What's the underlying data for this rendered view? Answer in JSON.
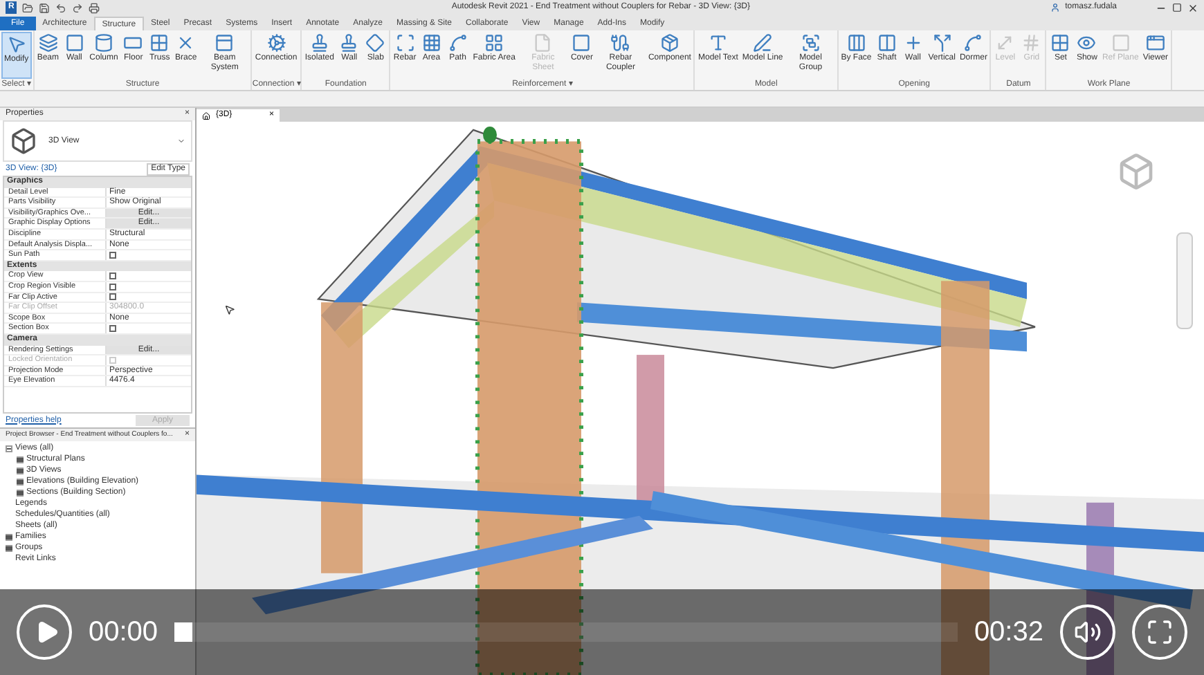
{
  "window": {
    "logo": "R",
    "title": "Autodesk Revit 2021 - End Treatment without Couplers for Rebar - 3D View: {3D}",
    "user": "tomasz.fudala"
  },
  "ribbon": {
    "tabs": [
      {
        "label": "File",
        "kind": "file",
        "selected": false
      },
      {
        "label": "Architecture",
        "kind": "tab",
        "selected": false
      },
      {
        "label": "Structure",
        "kind": "tab",
        "selected": true
      },
      {
        "label": "Steel",
        "kind": "tab",
        "selected": false
      },
      {
        "label": "Precast",
        "kind": "tab",
        "selected": false
      },
      {
        "label": "Systems",
        "kind": "tab",
        "selected": false
      },
      {
        "label": "Insert",
        "kind": "tab",
        "selected": false
      },
      {
        "label": "Annotate",
        "kind": "tab",
        "selected": false
      },
      {
        "label": "Analyze",
        "kind": "tab",
        "selected": false
      },
      {
        "label": "Massing & Site",
        "kind": "tab",
        "selected": false
      },
      {
        "label": "Collaborate",
        "kind": "tab",
        "selected": false
      },
      {
        "label": "View",
        "kind": "tab",
        "selected": false
      },
      {
        "label": "Manage",
        "kind": "tab",
        "selected": false
      },
      {
        "label": "Add-Ins",
        "kind": "tab",
        "selected": false
      },
      {
        "label": "Modify",
        "kind": "tab",
        "selected": false
      }
    ],
    "panels": [
      {
        "label": "Select ▾",
        "buttons": [
          {
            "label": "Modify",
            "selected": true,
            "disabled": false
          }
        ]
      },
      {
        "label": "Structure",
        "buttons": [
          {
            "label": "Beam",
            "selected": false,
            "disabled": false
          },
          {
            "label": "Wall",
            "selected": false,
            "disabled": false
          },
          {
            "label": "Column",
            "selected": false,
            "disabled": false
          },
          {
            "label": "Floor",
            "selected": false,
            "disabled": false
          },
          {
            "label": "Truss",
            "selected": false,
            "disabled": false
          },
          {
            "label": "Brace",
            "selected": false,
            "disabled": false
          },
          {
            "label": "Beam System",
            "selected": false,
            "disabled": false
          }
        ]
      },
      {
        "label": "Connection ▾",
        "buttons": [
          {
            "label": "Connection",
            "selected": false,
            "disabled": false
          }
        ]
      },
      {
        "label": "Foundation",
        "buttons": [
          {
            "label": "Isolated",
            "selected": false,
            "disabled": false
          },
          {
            "label": "Wall",
            "selected": false,
            "disabled": false
          },
          {
            "label": "Slab",
            "selected": false,
            "disabled": false
          }
        ]
      },
      {
        "label": "Reinforcement ▾",
        "buttons": [
          {
            "label": "Rebar",
            "selected": false,
            "disabled": false
          },
          {
            "label": "Area",
            "selected": false,
            "disabled": false
          },
          {
            "label": "Path",
            "selected": false,
            "disabled": false
          },
          {
            "label": "Fabric Area",
            "selected": false,
            "disabled": false
          },
          {
            "label": "Fabric Sheet",
            "selected": false,
            "disabled": true
          },
          {
            "label": "Cover",
            "selected": false,
            "disabled": false
          },
          {
            "label": "Rebar Coupler",
            "selected": false,
            "disabled": false
          },
          {
            "label": "Component",
            "selected": false,
            "disabled": false
          }
        ]
      },
      {
        "label": "Model",
        "buttons": [
          {
            "label": "Model Text",
            "selected": false,
            "disabled": false
          },
          {
            "label": "Model Line",
            "selected": false,
            "disabled": false
          },
          {
            "label": "Model Group",
            "selected": false,
            "disabled": false
          }
        ]
      },
      {
        "label": "Opening",
        "buttons": [
          {
            "label": "By Face",
            "selected": false,
            "disabled": false
          },
          {
            "label": "Shaft",
            "selected": false,
            "disabled": false
          },
          {
            "label": "Wall",
            "selected": false,
            "disabled": false
          },
          {
            "label": "Vertical",
            "selected": false,
            "disabled": false
          },
          {
            "label": "Dormer",
            "selected": false,
            "disabled": false
          }
        ]
      },
      {
        "label": "Datum",
        "buttons": [
          {
            "label": "Level",
            "selected": false,
            "disabled": true
          },
          {
            "label": "Grid",
            "selected": false,
            "disabled": true
          }
        ]
      },
      {
        "label": "Work Plane",
        "buttons": [
          {
            "label": "Set",
            "selected": false,
            "disabled": false
          },
          {
            "label": "Show",
            "selected": false,
            "disabled": false
          },
          {
            "label": "Ref Plane",
            "selected": false,
            "disabled": true
          },
          {
            "label": "Viewer",
            "selected": false,
            "disabled": false
          }
        ]
      }
    ]
  },
  "properties": {
    "title": "Properties",
    "close": "×",
    "type_name": "3D View",
    "instance": "3D View: {3D}",
    "edit_type": "Edit Type",
    "rows": [
      {
        "kind": "section",
        "label": "Graphics",
        "disabled": false
      },
      {
        "kind": "text",
        "label": "Detail Level",
        "value": "Fine",
        "disabled": false
      },
      {
        "kind": "text",
        "label": "Parts Visibility",
        "value": "Show Original",
        "disabled": false
      },
      {
        "kind": "button",
        "label": "Visibility/Graphics Ove...",
        "value": "Edit...",
        "disabled": false
      },
      {
        "kind": "button",
        "label": "Graphic Display Options",
        "value": "Edit...",
        "disabled": false
      },
      {
        "kind": "text",
        "label": "Discipline",
        "value": "Structural",
        "disabled": false
      },
      {
        "kind": "text",
        "label": "Default Analysis Displa...",
        "value": "None",
        "disabled": false
      },
      {
        "kind": "checkbox",
        "label": "Sun Path",
        "checked": false,
        "disabled": false
      },
      {
        "kind": "section",
        "label": "Extents",
        "disabled": false
      },
      {
        "kind": "checkbox",
        "label": "Crop View",
        "checked": false,
        "disabled": false
      },
      {
        "kind": "checkbox",
        "label": "Crop Region Visible",
        "checked": false,
        "disabled": false
      },
      {
        "kind": "checkbox",
        "label": "Far Clip Active",
        "checked": false,
        "disabled": false
      },
      {
        "kind": "text",
        "label": "Far Clip Offset",
        "value": "304800.0",
        "disabled": true
      },
      {
        "kind": "text",
        "label": "Scope Box",
        "value": "None",
        "disabled": false
      },
      {
        "kind": "checkbox",
        "label": "Section Box",
        "checked": false,
        "disabled": false
      },
      {
        "kind": "section",
        "label": "Camera",
        "disabled": false
      },
      {
        "kind": "button",
        "label": "Rendering Settings",
        "value": "Edit...",
        "disabled": false
      },
      {
        "kind": "checkbox",
        "label": "Locked Orientation",
        "checked": false,
        "disabled": true
      },
      {
        "kind": "text",
        "label": "Projection Mode",
        "value": "Perspective",
        "disabled": false
      },
      {
        "kind": "text",
        "label": "Eye Elevation",
        "value": "4476.4",
        "disabled": false
      }
    ],
    "help_link": "Properties help",
    "apply": "Apply"
  },
  "project_browser": {
    "title": "Project Browser - End Treatment without Couplers fo...",
    "close": "×",
    "items": [
      {
        "label": "Views (all)",
        "kind": "group",
        "expanded": true,
        "children": [
          {
            "label": "Structural Plans",
            "kind": "group",
            "expanded": false
          },
          {
            "label": "3D Views",
            "kind": "group",
            "expanded": false
          },
          {
            "label": "Elevations (Building Elevation)",
            "kind": "group",
            "expanded": false
          },
          {
            "label": "Sections (Building Section)",
            "kind": "group",
            "expanded": false
          }
        ]
      },
      {
        "label": "Legends",
        "kind": "leaf"
      },
      {
        "label": "Schedules/Quantities (all)",
        "kind": "leaf"
      },
      {
        "label": "Sheets (all)",
        "kind": "leaf"
      },
      {
        "label": "Families",
        "kind": "group",
        "expanded": false
      },
      {
        "label": "Groups",
        "kind": "group",
        "expanded": false
      },
      {
        "label": "Revit Links",
        "kind": "leaf"
      }
    ]
  },
  "view_tab": {
    "label": "{3D}",
    "close": "×"
  },
  "player": {
    "playing": false,
    "elapsed": "00:00",
    "level": 0,
    "duration": "00:32",
    "muted": false
  }
}
